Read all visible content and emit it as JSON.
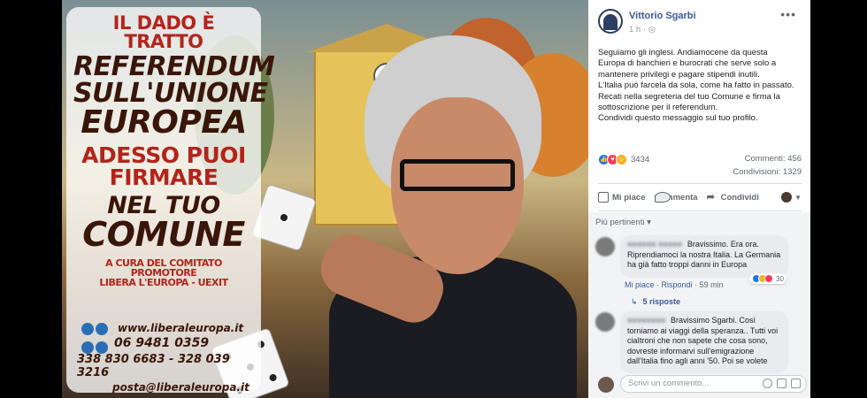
{
  "poster": {
    "line1": "IL DADO È TRATTO",
    "line2": "REFERENDUM",
    "line3": "SULL'UNIONE",
    "line4": "EUROPEA",
    "line5": "ADESSO PUOI",
    "line6": "FIRMARE",
    "line7": "NEL TUO",
    "line8": "COMUNE",
    "line9": "A CURA DEL COMITATO PROMOTORE",
    "line10": "LIBERA L'EUROPA - UEXIT",
    "website": "www.liberaleuropa.it",
    "phone1": "06 9481 0359",
    "phone2": "338 830 6683 - 328 039 3216",
    "email": "posta@liberaleuropa.it"
  },
  "post": {
    "author": "Vittorio Sgarbi",
    "time": "1 h",
    "globe": "◎",
    "more": "•••",
    "text_lines": [
      "Seguiamo gli inglesi. Andiamocene da questa",
      "Europa di banchieri e burocrati che serve solo a",
      "mantenere privilegi e pagare stipendi inutili.",
      "L'Italia può farcela da sola, come ha fatto in passato.",
      "Recati nella segreteria del tuo Comune e firma la",
      "sottoscrizione per il referendum.",
      "Condividi questo messaggio sul tuo profilo."
    ],
    "reaction_count": "3434",
    "comments": "Commenti: 456",
    "shares": "Condivisioni: 1329"
  },
  "actions": {
    "like": "Mi piace",
    "comment": "Commenta",
    "share": "Condividi"
  },
  "relevant": "Più pertinenti ▾",
  "comments": [
    {
      "name": "■■■■■■ ■■■■■",
      "lines": [
        "Bravissimo. Era ora.",
        "Riprendiamoci la nostra Italia. La Germania",
        "ha già fatto troppi danni in Europa"
      ],
      "like_label": "Mi piace",
      "reply_label": "Rispondi",
      "time": "59 min",
      "reaction_count": "30"
    },
    {
      "name": "■■■■■■■■",
      "lines": [
        "Bravissimo Sgarbi. Così",
        "torniamo ai viaggi della speranza.. Tutti voi",
        "ciaItroni che non sapete che cosa sono,",
        "dovreste informarvi sull'emigrazione",
        "dall'Italia fino agli anni '50. Poi se volete"
      ]
    }
  ],
  "replies_label": "5 risposte",
  "write_placeholder": "Scrivi un commento..."
}
